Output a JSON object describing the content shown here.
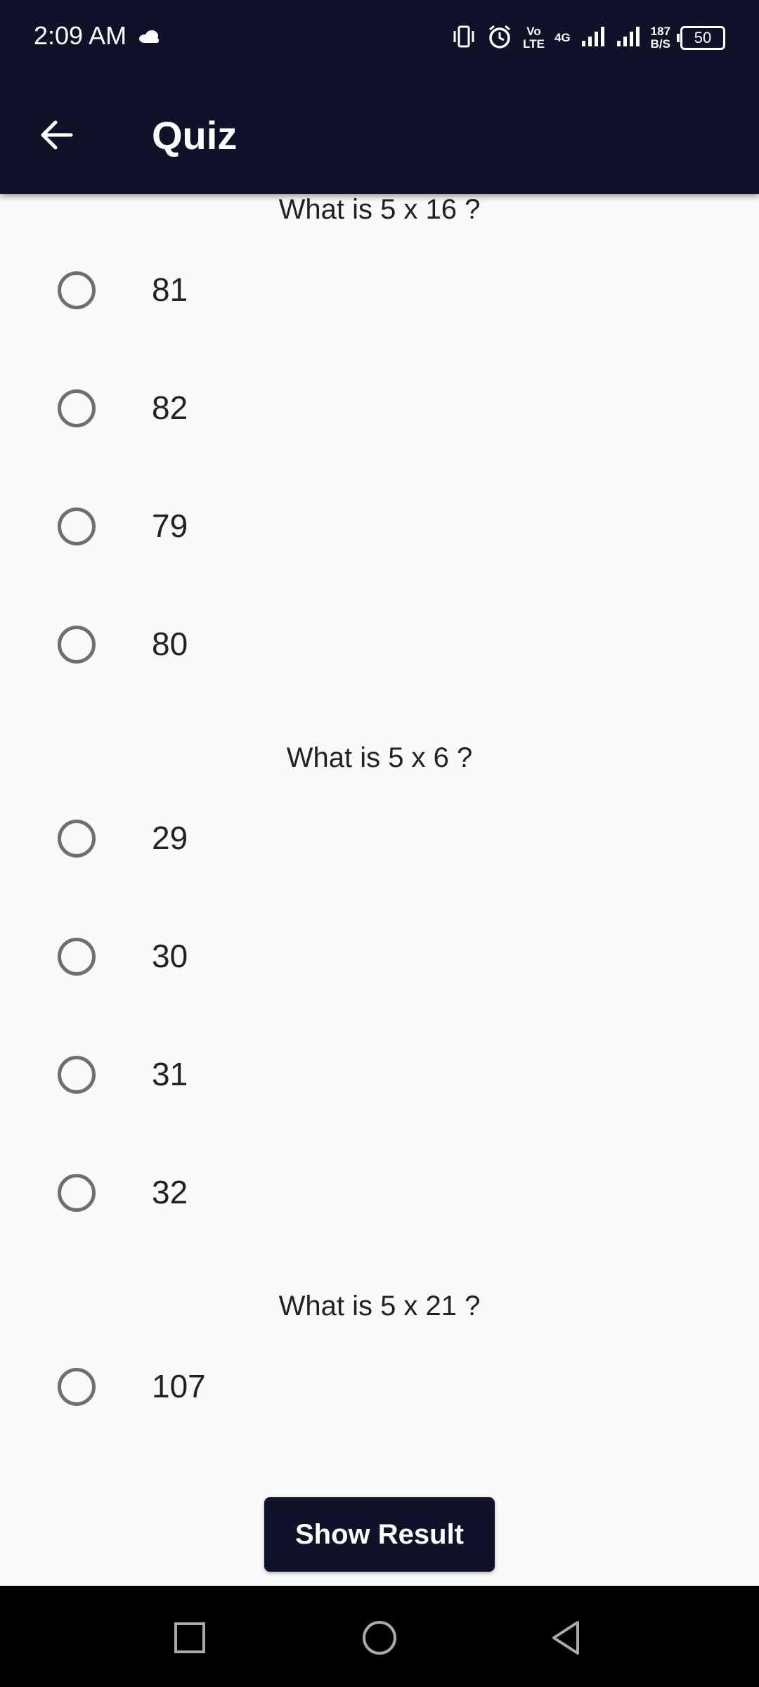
{
  "status_bar": {
    "time": "2:09 AM",
    "volte_top": "Vo",
    "volte_bottom": "LTE",
    "network": "4G",
    "speed_top": "187",
    "speed_bottom": "B/S",
    "battery": "50"
  },
  "app_bar": {
    "title": "Quiz"
  },
  "questions": [
    {
      "text": "What is 5 x 16 ?",
      "options": [
        "81",
        "82",
        "79",
        "80"
      ]
    },
    {
      "text": "What is 5 x 6 ?",
      "options": [
        "29",
        "30",
        "31",
        "32"
      ]
    },
    {
      "text": "What is 5 x 21 ?",
      "options": [
        "107"
      ]
    }
  ],
  "actions": {
    "show_result_label": "Show Result"
  },
  "colors": {
    "primary": "#10122a",
    "background": "#fafafa",
    "radio": "#6f6f6f"
  }
}
